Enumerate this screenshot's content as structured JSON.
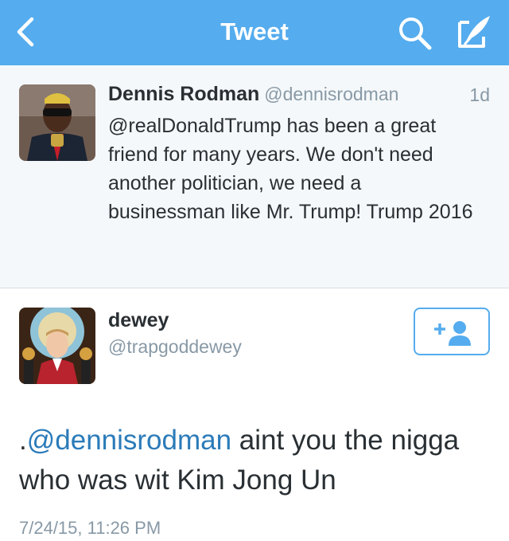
{
  "navbar": {
    "title": "Tweet",
    "background_color": "#55acee",
    "icons": [
      "chevron-left-icon",
      "search-icon",
      "compose-icon"
    ]
  },
  "parent_tweet": {
    "name": "Dennis Rodman",
    "handle": "@dennisrodman",
    "time": "1d",
    "text": "@realDonaldTrump has been a great friend for many years. We don't need another politician, we need a businessman like Mr. Trump! Trump 2016"
  },
  "main_tweet": {
    "name": "dewey",
    "handle": "@trapgoddewey",
    "text_prefix": ".",
    "mention": "@dennisrodman",
    "text_rest": " aint you the nigga who was wit Kim Jong Un",
    "timestamp": "7/24/15, 11:26 PM",
    "follow_icon": "add-user-icon"
  },
  "colors": {
    "accent": "#55acee",
    "mention": "#2b7bb9",
    "secondary_text": "#8899a6",
    "primary_text": "#292f33"
  }
}
